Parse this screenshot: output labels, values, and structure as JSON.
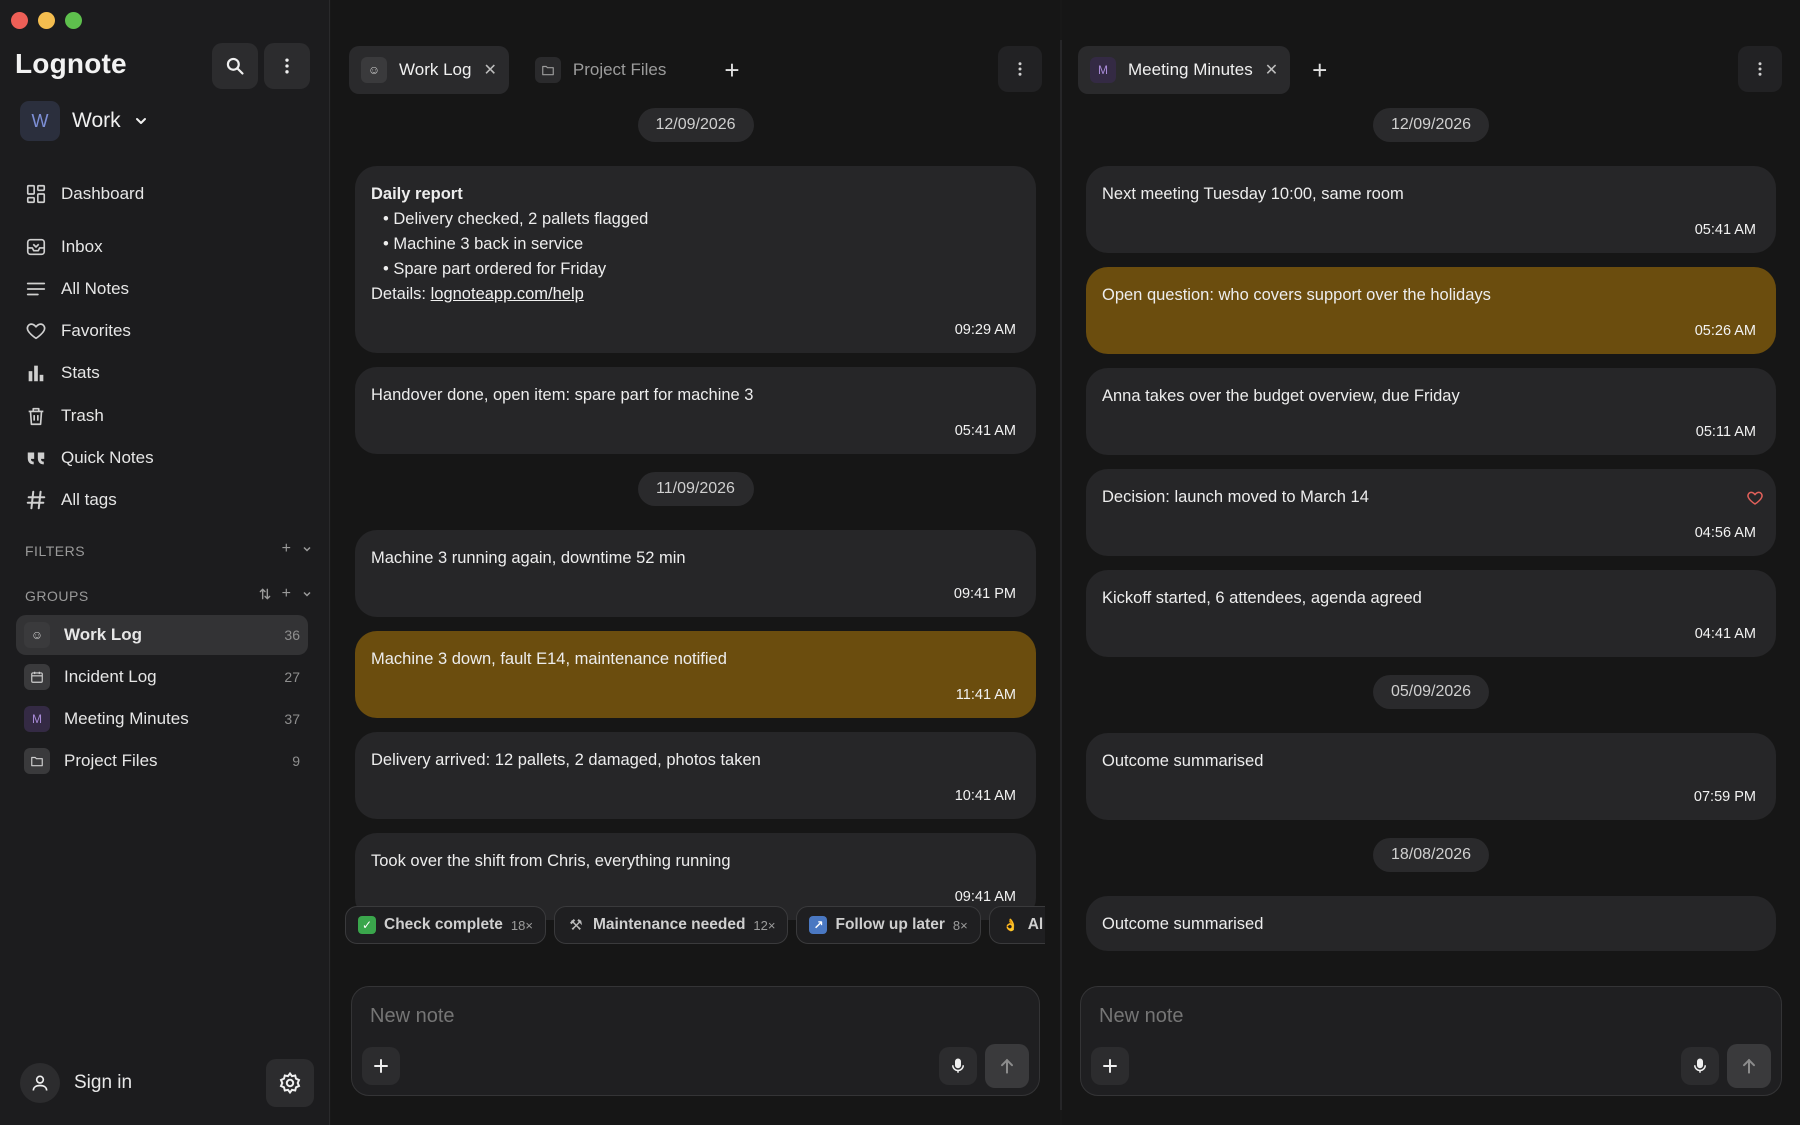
{
  "app": {
    "title": "Lognote"
  },
  "workspace": {
    "avatar": "W",
    "name": "Work"
  },
  "nav": [
    {
      "label": "Dashboard",
      "icon": "dashboard-icon"
    },
    {
      "label": "Inbox",
      "icon": "inbox-icon"
    },
    {
      "label": "All Notes",
      "icon": "list-icon"
    },
    {
      "label": "Favorites",
      "icon": "heart-icon"
    },
    {
      "label": "Stats",
      "icon": "bar-chart-icon"
    },
    {
      "label": "Trash",
      "icon": "trash-icon"
    },
    {
      "label": "Quick Notes",
      "icon": "quote-icon"
    },
    {
      "label": "All tags",
      "icon": "hash-icon"
    }
  ],
  "filters": {
    "label": "FILTERS"
  },
  "groups": {
    "label": "GROUPS",
    "items": [
      {
        "name": "Work Log",
        "count": "36",
        "icon": "emoji-icon",
        "active": true
      },
      {
        "name": "Incident Log",
        "count": "27",
        "icon": "calendar-icon"
      },
      {
        "name": "Meeting Minutes",
        "count": "37",
        "icon": "letter-m-icon",
        "letter": "M"
      },
      {
        "name": "Project Files",
        "count": "9",
        "icon": "folder-icon"
      }
    ]
  },
  "signin": {
    "label": "Sign in"
  },
  "left_pane": {
    "tabs": [
      {
        "label": "Work Log",
        "active": true
      },
      {
        "label": "Project Files",
        "active": false
      }
    ],
    "dates": [
      "12/09/2026",
      "11/09/2026"
    ],
    "notes": {
      "daily": {
        "title": "Daily report",
        "bullets": [
          "Delivery checked, 2 pallets flagged",
          "Machine 3 back in service",
          "Spare part ordered for Friday"
        ],
        "details_prefix": "Details: ",
        "link": "lognoteapp.com/help",
        "time": "09:29 AM"
      },
      "n2": {
        "text": "Handover done, open item: spare part for machine 3",
        "time": "05:41 AM"
      },
      "n3": {
        "text": "Machine 3 running again, downtime 52 min",
        "time": "09:41 PM"
      },
      "n4": {
        "text": "Machine 3 down, fault E14, maintenance notified",
        "time": "11:41 AM"
      },
      "n5": {
        "text": "Delivery arrived: 12 pallets, 2 damaged, photos taken",
        "time": "10:41 AM"
      },
      "n6": {
        "text": "Took over the shift from Chris, everything running",
        "time": "09:41 AM"
      }
    },
    "chips": [
      {
        "label": "Check complete",
        "count": "18×",
        "color": "#3aa64c",
        "glyph": "✓"
      },
      {
        "label": "Maintenance needed",
        "count": "12×",
        "color": "#555555",
        "glyph": "⚒"
      },
      {
        "label": "Follow up later",
        "count": "8×",
        "color": "#4a78c2",
        "glyph": "↗"
      },
      {
        "label": "Al",
        "count": "",
        "color": "#d6a34a",
        "glyph": "👌"
      }
    ],
    "composer_placeholder": "New note"
  },
  "right_pane": {
    "tab": {
      "label": "Meeting Minutes",
      "letter": "M"
    },
    "dates": [
      "12/09/2026",
      "05/09/2026",
      "18/08/2026"
    ],
    "notes": [
      {
        "text": "Next meeting Tuesday 10:00, same room",
        "time": "05:41 AM"
      },
      {
        "text": "Open question: who covers support over the holidays",
        "time": "05:26 AM"
      },
      {
        "text": "Anna takes over the budget overview, due Friday",
        "time": "05:11 AM"
      },
      {
        "text": "Decision: launch moved to March 14",
        "time": "04:56 AM"
      },
      {
        "text": "Kickoff started, 6 attendees, agenda agreed",
        "time": "04:41 AM"
      },
      {
        "text": "Outcome summarised",
        "time": "07:59 PM"
      },
      {
        "text": "Outcome summarised",
        "time": ""
      }
    ],
    "composer_placeholder": "New note"
  },
  "colors": {
    "highlight": "#6b4d0e",
    "accent": "#7d8fd6",
    "favorite": "#e0605a"
  }
}
